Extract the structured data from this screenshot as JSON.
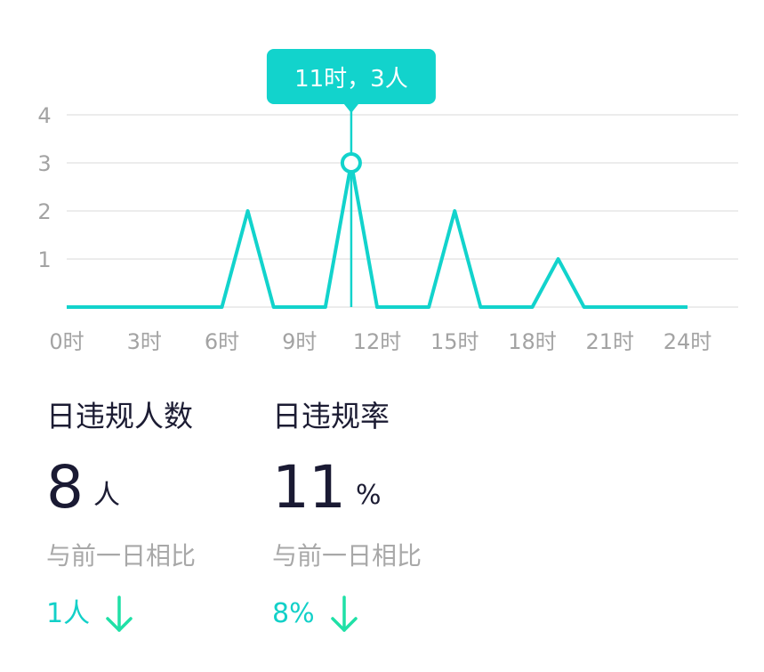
{
  "chart_data": {
    "type": "line",
    "x": [
      0,
      1,
      2,
      3,
      4,
      5,
      6,
      7,
      8,
      9,
      10,
      11,
      12,
      13,
      14,
      15,
      16,
      17,
      18,
      19,
      20,
      21,
      22,
      23
    ],
    "values": [
      0,
      0,
      0,
      0,
      0,
      0,
      0,
      2,
      0,
      0,
      0,
      3,
      0,
      0,
      0,
      2,
      0,
      0,
      0,
      1,
      0,
      0,
      0,
      0
    ],
    "xticks": [
      "0时",
      "3时",
      "6时",
      "9时",
      "12时",
      "15时",
      "18时",
      "21时",
      "24时"
    ],
    "yticks": [
      "1",
      "2",
      "3",
      "4"
    ],
    "ylim": [
      0,
      4
    ],
    "xlim": [
      0,
      24
    ],
    "grid": true,
    "line_color": "#12d3cc",
    "tooltip": {
      "text": "11时，3人",
      "x": 11,
      "y": 3
    }
  },
  "stats": [
    {
      "title": "日违规人数",
      "value": "8",
      "unit": "人",
      "compare_label": "与前一日相比",
      "change": "1人",
      "direction_icon": "down-arrow-icon"
    },
    {
      "title": "日违规率",
      "value": "11",
      "unit": "%",
      "compare_label": "与前一日相比",
      "change": "8%",
      "direction_icon": "down-arrow-icon"
    }
  ],
  "colors": {
    "accent": "#12d3cc",
    "arrow": "#1fe0a6",
    "text_dark": "#1c1c33",
    "text_muted": "#a3a3a3",
    "grid": "#ececec"
  }
}
